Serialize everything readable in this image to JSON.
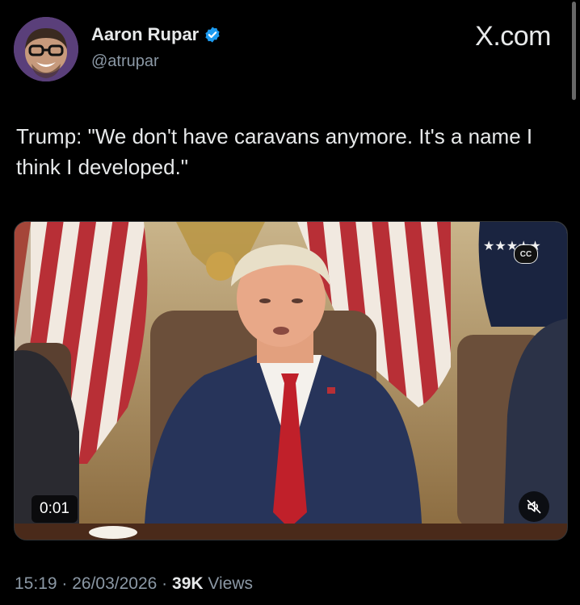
{
  "author": {
    "display_name": "Aaron Rupar",
    "handle": "@atrupar",
    "verified": true,
    "avatar_icon": "avatar-photo-icon"
  },
  "brand": {
    "label": "X.com"
  },
  "tweet": {
    "text": "Trump: \"We don't have caravans anymore. It's a name I think I developed.\""
  },
  "video": {
    "elapsed": "0:01",
    "captions_label": "CC",
    "mute_icon": "muted-speaker-icon"
  },
  "meta": {
    "time": "15:19",
    "sep1": " · ",
    "date": "26/03/2026",
    "sep2": " · ",
    "views_count": "39K",
    "views_label": " Views"
  },
  "colors": {
    "background": "#000000",
    "text_primary": "#e7e9ea",
    "text_secondary": "#8b98a5",
    "verified_blue": "#1d9bf0"
  }
}
